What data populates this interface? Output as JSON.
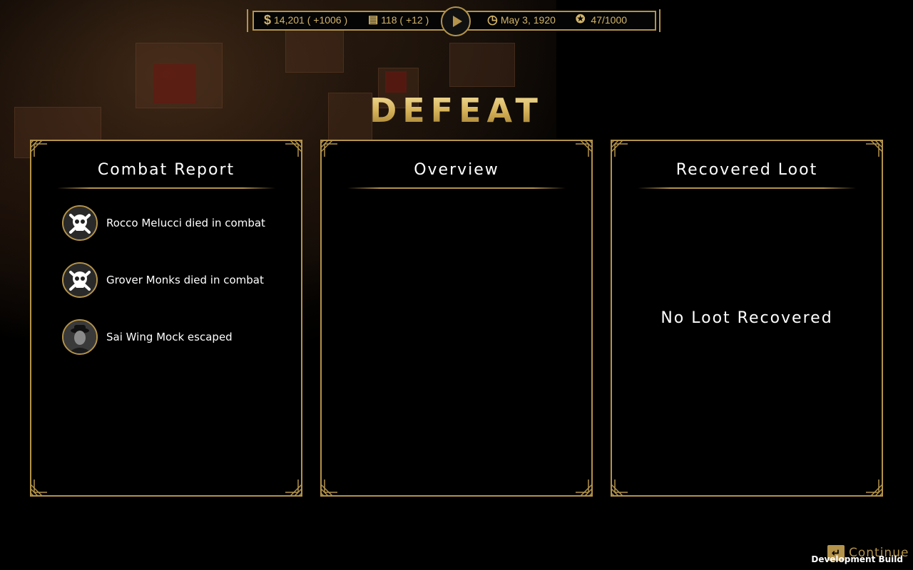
{
  "topbar": {
    "money": "14,201 ( +1006 )",
    "supplies": "118 ( +12 )",
    "date": "May 3, 1920",
    "heat": "47/1000",
    "icons": {
      "money": "dollar-icon",
      "supplies": "crate-icon",
      "play": "play-icon",
      "date": "clock-icon",
      "heat": "star-badge-icon"
    }
  },
  "result_title": "DEFEAT",
  "panels": {
    "combat_report": {
      "title": "Combat Report",
      "items": [
        {
          "text": "Rocco Melucci died in combat",
          "icon": "skull-crossbones-icon"
        },
        {
          "text": "Grover Monks died in combat",
          "icon": "skull-crossbones-icon"
        },
        {
          "text": "Sai Wing Mock escaped",
          "icon": "character-portrait"
        }
      ]
    },
    "overview": {
      "title": "Overview"
    },
    "recovered_loot": {
      "title": "Recovered Loot",
      "empty_text": "No Loot Recovered"
    }
  },
  "footer": {
    "continue_label": "Continue",
    "continue_key": "↵",
    "dev_build": "Development Build"
  },
  "colors": {
    "gold": "#b4934a",
    "background": "#000000",
    "text": "#ffffff"
  }
}
